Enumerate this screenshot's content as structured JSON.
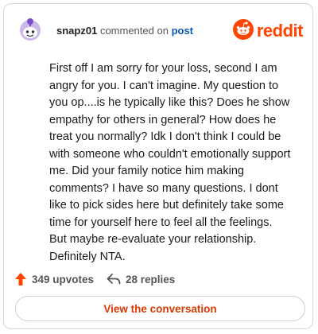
{
  "header": {
    "username": "snapz01",
    "action_text": "commented on",
    "post_link": "post",
    "brand": "reddit"
  },
  "comment": {
    "text": "First off I am sorry for your loss, second I am angry for you. I can't imagine. My question to you op....is he typically like this? Does he show empathy for others in general? How does he treat you normally? Idk I don't think I could be with someone who couldn't emotionally support me. Did your family notice him making comments? I have so many questions. I dont like to pick sides here but definitely take some time for yourself here to feel all the feelings. But maybe re-evaluate your relationship. Definitely NTA."
  },
  "stats": {
    "upvotes": "349 upvotes",
    "replies": "28 replies"
  },
  "cta": {
    "label": "View the conversation"
  },
  "colors": {
    "brand": "#ff4500",
    "link": "#0a58b8",
    "cta": "#d93900"
  },
  "icons": {
    "avatar": "snoo-avatar-icon",
    "logo": "reddit-logo-icon",
    "upvote": "upvote-arrow-icon",
    "reply": "reply-arrow-icon"
  }
}
